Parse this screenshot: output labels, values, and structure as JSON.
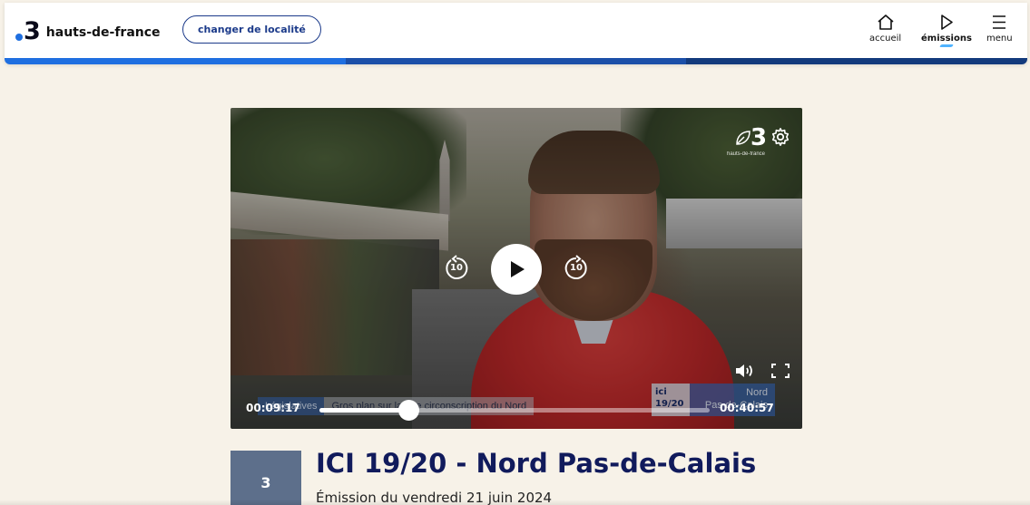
{
  "header": {
    "logo_number": "3",
    "logo_text": "hauts-de-france",
    "change_locality_label": "changer de localité",
    "nav": [
      {
        "label": "accueil",
        "icon": "home-icon"
      },
      {
        "label": "émissions",
        "icon": "play-icon",
        "active": true
      },
      {
        "label": "menu",
        "icon": "hamburger-icon"
      }
    ],
    "strip_colors": [
      "#1f6fe0",
      "#1b4fa8",
      "#133a7c"
    ]
  },
  "player": {
    "brand_number": "3",
    "brand_sub": "hauts-de-france",
    "rewind_seconds": "10",
    "forward_seconds": "10",
    "current_time": "00:09:17",
    "duration": "00:40:57",
    "progress_fraction": 0.227,
    "lower_third_category": "Législatives",
    "lower_third_title": "Gros plan sur la 20e circonscription du Nord",
    "region_brand": "ici",
    "region_edition": "19/20",
    "region_name_line1": "Nord",
    "region_name_line2": "Pas-de-Calais"
  },
  "program": {
    "thumb_label": "3",
    "title": "ICI 19/20 - Nord Pas-de-Calais",
    "date": "Émission du vendredi 21 juin 2024"
  }
}
